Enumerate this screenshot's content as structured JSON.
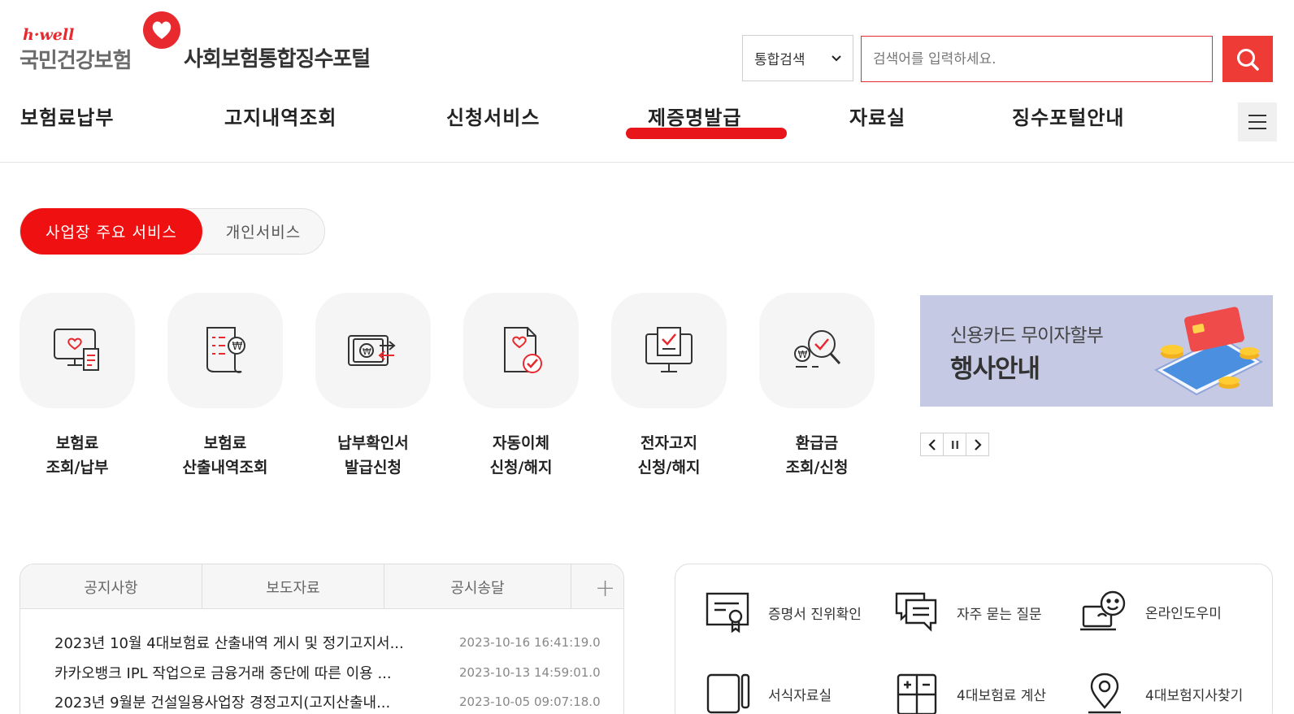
{
  "header": {
    "logo_tag": "h·well",
    "logo_org": "국민건강보험",
    "portal_title": "사회보험통합징수포털",
    "search": {
      "scope": "통합검색",
      "placeholder": "검색어를 입력하세요."
    }
  },
  "gnb": {
    "items": [
      "보험료납부",
      "고지내역조회",
      "신청서비스",
      "제증명발급",
      "자료실",
      "징수포털안내"
    ],
    "active_index": 3
  },
  "service_tabs": {
    "active": "사업장 주요 서비스",
    "other": "개인서비스"
  },
  "quick_services": [
    {
      "line1": "보험료",
      "line2": "조회/납부",
      "icon": "monitor-bill-icon"
    },
    {
      "line1": "보험료",
      "line2": "산출내역조회",
      "icon": "document-won-icon"
    },
    {
      "line1": "납부확인서",
      "line2": "발급신청",
      "icon": "payment-transfer-icon"
    },
    {
      "line1": "자동이체",
      "line2": "신청/해지",
      "icon": "document-check-icon"
    },
    {
      "line1": "전자고지",
      "line2": "신청/해지",
      "icon": "monitor-check-icon"
    },
    {
      "line1": "환급금",
      "line2": "조회/신청",
      "icon": "refund-search-icon"
    }
  ],
  "banner": {
    "subtitle": "신용카드 무이자할부",
    "title": "행사안내"
  },
  "board": {
    "tabs": [
      "공지사항",
      "보도자료",
      "공시송달"
    ],
    "notices": [
      {
        "title": "2023년 10월 4대보험료 산출내역 게시 및 정기고지서...",
        "date": "2023-10-16 16:41:19.0"
      },
      {
        "title": "카카오뱅크 IPL 작업으로 금융거래 중단에 따른 이용 ...",
        "date": "2023-10-13 14:59:01.0"
      },
      {
        "title": "2023년 9월분 건설일용사업장 경정고지(고지산출내...",
        "date": "2023-10-05 09:07:18.0"
      }
    ]
  },
  "quick_links": [
    {
      "label": "증명서 진위확인",
      "icon": "certificate-icon"
    },
    {
      "label": "자주 묻는 질문",
      "icon": "faq-chat-icon"
    },
    {
      "label": "온라인도우미",
      "icon": "online-helper-icon"
    },
    {
      "label": "서식자료실",
      "icon": "form-archive-icon"
    },
    {
      "label": "4대보험료 계산",
      "icon": "calculator-icon"
    },
    {
      "label": "4대보험지사찾기",
      "icon": "location-pin-icon"
    }
  ],
  "colors": {
    "brand_red": "#ef1111",
    "banner_bg": "#c6c9e4"
  }
}
